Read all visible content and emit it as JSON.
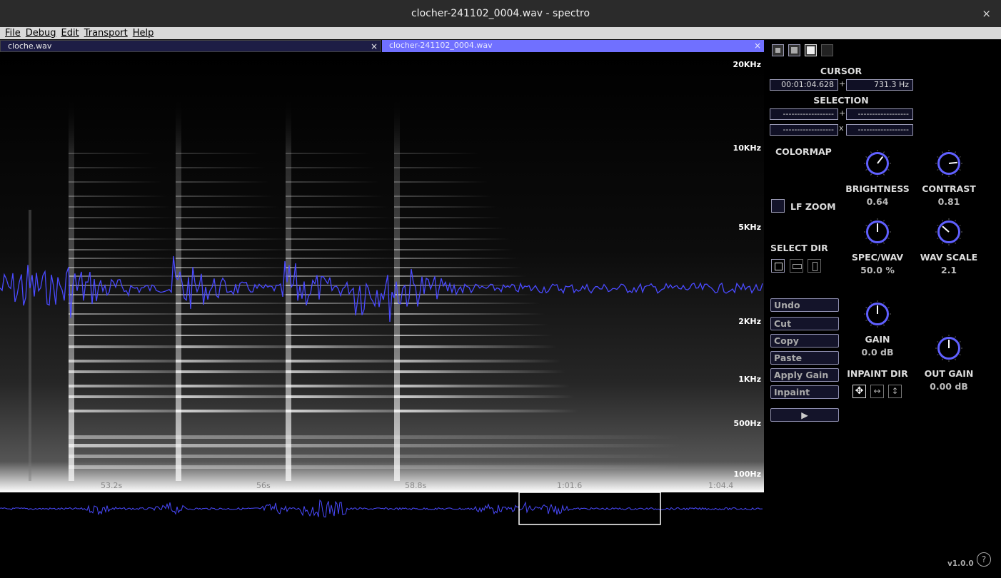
{
  "window": {
    "title": "clocher-241102_0004.wav - spectro",
    "close_symbol": "×"
  },
  "menu": [
    "File",
    "Debug",
    "Edit",
    "Transport",
    "Help"
  ],
  "tabs": [
    {
      "label": "cloche.wav",
      "close": "×",
      "active": false
    },
    {
      "label": "clocher-241102_0004.wav",
      "close": "×",
      "active": true
    }
  ],
  "spectrogram": {
    "freq_labels": [
      "20KHz",
      "10KHz",
      "5KHz",
      "2KHz",
      "1KHz",
      "500Hz",
      "100Hz"
    ],
    "time_labels": [
      "53.2s",
      "56s",
      "58.8s",
      "1:01.6",
      "1:04.4"
    ]
  },
  "panel": {
    "cursor_title": "CURSOR",
    "cursor_time": "00:01:04.628",
    "cursor_plus": "+",
    "cursor_freq": "731.3 Hz",
    "selection_title": "SELECTION",
    "selection_fields": [
      "------------------",
      "------------------",
      "------------------",
      "------------------"
    ],
    "selection_plus": "+",
    "selection_times": "x",
    "colormap_label": "COLORMAP",
    "lf_zoom_label": "LF ZOOM",
    "select_dir_label": "SELECT DIR",
    "brightness": {
      "label": "BRIGHTNESS",
      "value": "0.64"
    },
    "contrast": {
      "label": "CONTRAST",
      "value": "0.81"
    },
    "spec_wav": {
      "label": "SPEC/WAV",
      "value": "50.0 %"
    },
    "wav_scale": {
      "label": "WAV SCALE",
      "value": "2.1"
    },
    "gain": {
      "label": "GAIN",
      "value": "0.0 dB"
    },
    "out_gain": {
      "label": "OUT GAIN",
      "value": "0.00 dB"
    },
    "inpaint_dir_label": "INPAINT DIR",
    "buttons": {
      "undo": "Undo",
      "cut": "Cut",
      "copy": "Copy",
      "paste": "Paste",
      "apply_gain": "Apply Gain",
      "inpaint": "Inpaint"
    },
    "play_icon": "▶",
    "version": "v1.0.0",
    "help_symbol": "?"
  },
  "colors": {
    "accent": "#5555ff",
    "tab_active": "#7070ff",
    "field_border": "#9a9ab5"
  }
}
